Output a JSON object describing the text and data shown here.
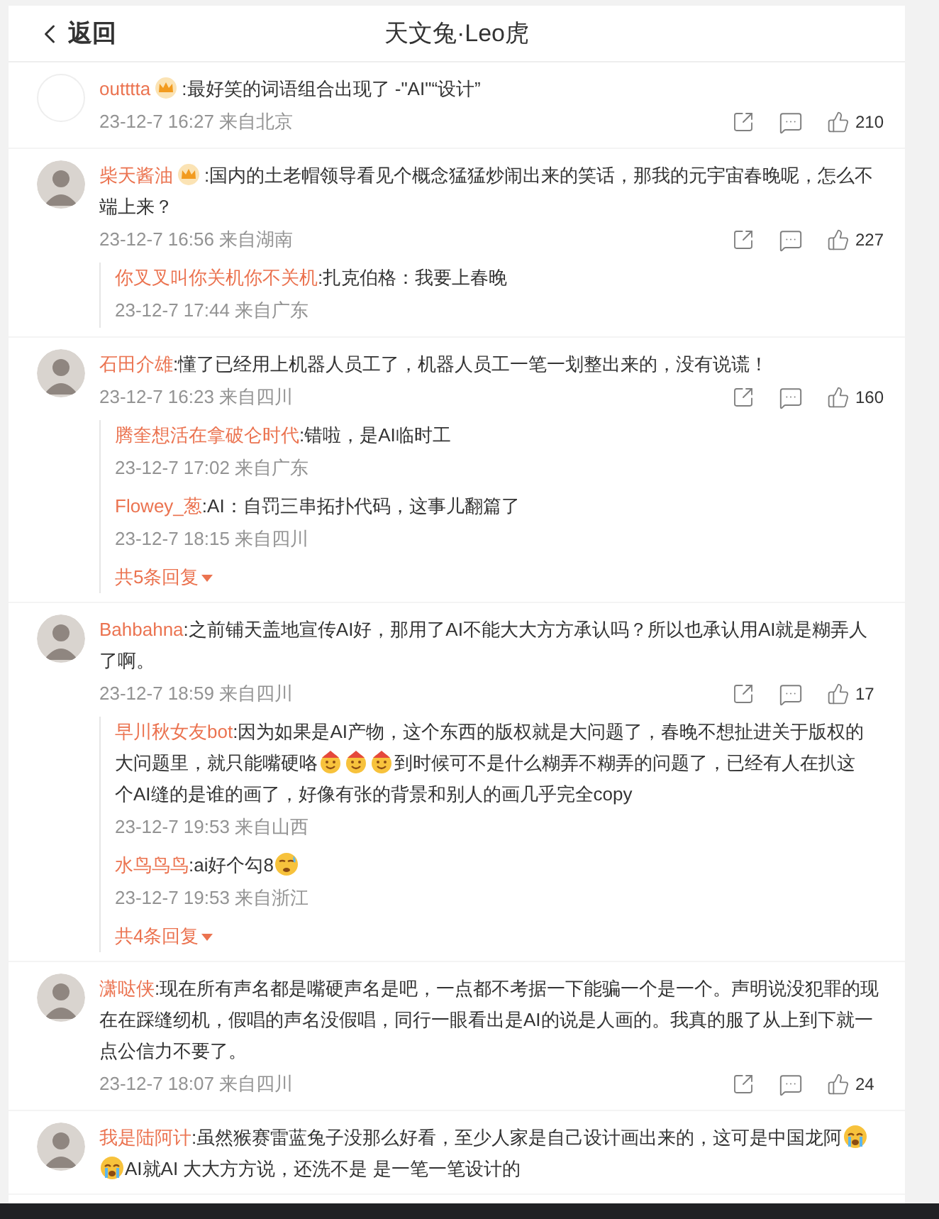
{
  "header": {
    "back": "返回",
    "title": "天文兔·Leo虎"
  },
  "comments": [
    {
      "avatar": {
        "kind": "blank"
      },
      "name": "outttta",
      "badge": true,
      "segments": [
        {
          "kind": "text",
          "text": ":最好笑的词语组合出现了 -\"AI\"“设计”"
        }
      ],
      "time": "23-12-7 16:27 来自北京",
      "likes": "210"
    },
    {
      "avatar": {
        "kind": "picture"
      },
      "name": "柴天酱油",
      "badge": true,
      "segments": [
        {
          "kind": "text",
          "text": ":国内的土老帽领导看见个概念猛猛炒闹出来的笑话，那我的元宇宙春晚呢，怎么不端上来？"
        }
      ],
      "time": "23-12-7 16:56 来自湖南",
      "likes": "227",
      "replies": [
        {
          "name": "你叉叉叫你关机你不关机",
          "segments": [
            {
              "kind": "text",
              "text": ":扎克伯格：我要上春晚"
            }
          ],
          "time": "23-12-7 17:44 来自广东"
        }
      ]
    },
    {
      "avatar": {
        "kind": "picture"
      },
      "name": "石田介雄",
      "badge": false,
      "segments": [
        {
          "kind": "text",
          "text": ":懂了已经用上机器人员工了，机器人员工一笔一划整出来的，没有说谎！"
        }
      ],
      "time": "23-12-7 16:23 来自四川",
      "likes": "160",
      "replies": [
        {
          "name": "腾奎想活在拿破仑时代",
          "segments": [
            {
              "kind": "text",
              "text": ":错啦，是AI临时工"
            }
          ],
          "time": "23-12-7 17:02 来自广东"
        },
        {
          "name": "Flowey_葱",
          "segments": [
            {
              "kind": "text",
              "text": ":AI：自罚三串拓扑代码，这事儿翻篇了"
            }
          ],
          "time": "23-12-7 18:15 来自四川"
        }
      ],
      "more": "共5条回复"
    },
    {
      "avatar": {
        "kind": "picture"
      },
      "name": "Bahbahna",
      "badge": false,
      "segments": [
        {
          "kind": "text",
          "text": ":之前铺天盖地宣传AI好，那用了AI不能大大方方承认吗？所以也承认用AI就是糊弄人了啊。"
        }
      ],
      "time": "23-12-7 18:59 来自四川",
      "likes": "17",
      "replies": [
        {
          "name": "早川秋女友bot",
          "segments": [
            {
              "kind": "text",
              "text": ":因为如果是AI产物，这个东西的版权就是大问题了，春晚不想扯进关于版权的大问题里，就只能嘴硬咯"
            },
            {
              "kind": "party"
            },
            {
              "kind": "party"
            },
            {
              "kind": "party"
            },
            {
              "kind": "text",
              "text": "到时候可不是什么糊弄不糊弄的问题了，已经有人在扒这个AI缝的是谁的画了，好像有张的背景和别人的画几乎完全copy"
            }
          ],
          "time": "23-12-7 19:53 来自山西"
        },
        {
          "name": "水鸟鸟鸟",
          "segments": [
            {
              "kind": "text",
              "text": ":ai好个勾8"
            },
            {
              "kind": "sweat"
            }
          ],
          "time": "23-12-7 19:53 来自浙江"
        }
      ],
      "more": "共4条回复"
    },
    {
      "avatar": {
        "kind": "picture"
      },
      "name": "潇哒侠",
      "badge": false,
      "segments": [
        {
          "kind": "text",
          "text": ":现在所有声名都是嘴硬声名是吧，一点都不考据一下能骗一个是一个。声明说没犯罪的现在在踩缝纫机，假唱的声名没假唱，同行一眼看出是AI的说是人画的。我真的服了从上到下就一点公信力不要了。"
        }
      ],
      "time": "23-12-7 18:07 来自四川",
      "likes": "24"
    },
    {
      "avatar": {
        "kind": "picture"
      },
      "name": "我是陆阿计",
      "badge": false,
      "segments": [
        {
          "kind": "text",
          "text": ":虽然猴赛雷蓝兔子没那么好看，至少人家是自己设计画出来的，这可是中国龙阿"
        },
        {
          "kind": "sob"
        },
        {
          "kind": "sob"
        },
        {
          "kind": "text",
          "text": "AI就AI 大大方方说，还洗不是 是一笔一笔设计的"
        }
      ]
    }
  ]
}
